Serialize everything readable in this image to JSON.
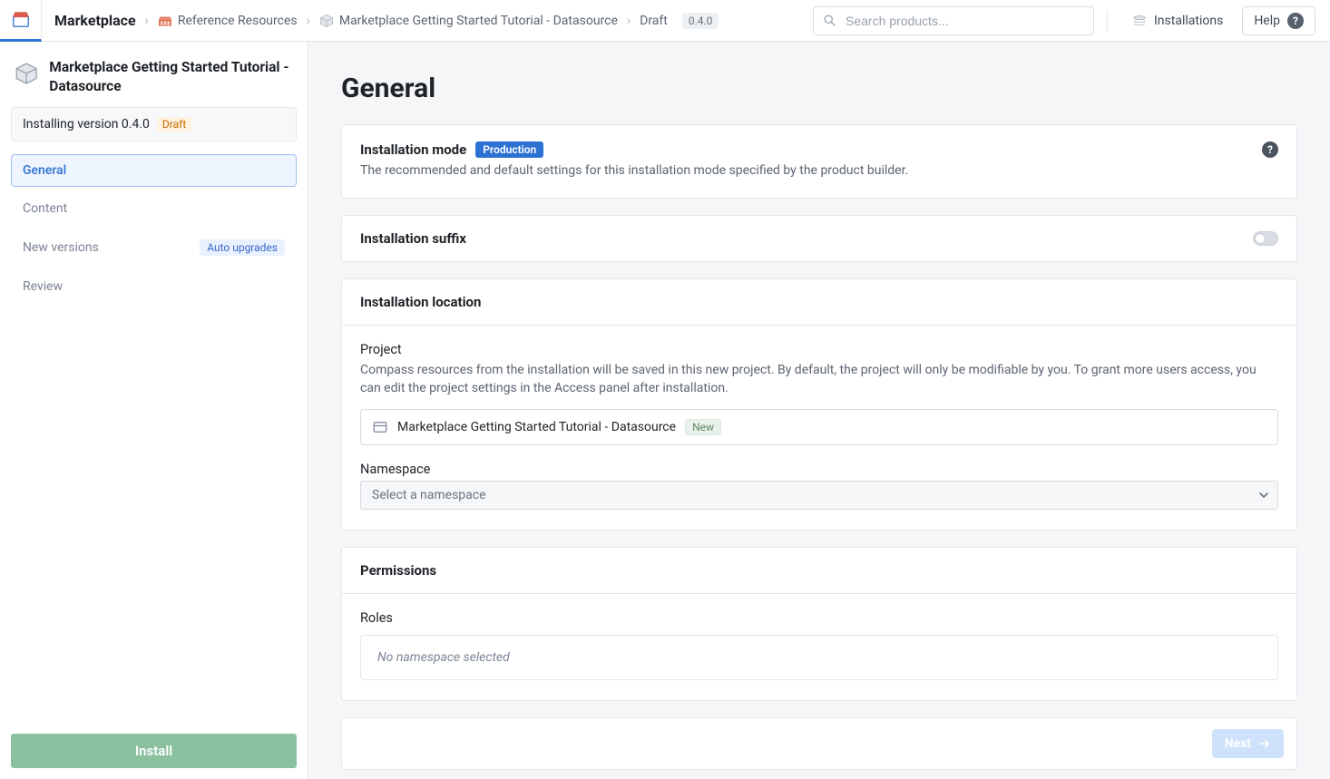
{
  "header": {
    "title": "Marketplace",
    "breadcrumbs": {
      "reference": "Reference Resources",
      "product": "Marketplace Getting Started Tutorial - Datasource",
      "stage": "Draft",
      "version": "0.4.0"
    },
    "search_placeholder": "Search products...",
    "installations": "Installations",
    "help": "Help"
  },
  "sidebar": {
    "title": "Marketplace Getting Started Tutorial - Datasource",
    "installing_line": "Installing version 0.4.0",
    "draft_label": "Draft",
    "nav": {
      "general": "General",
      "content": "Content",
      "new_versions": "New versions",
      "review": "Review"
    },
    "auto_upgrades": "Auto upgrades",
    "install": "Install"
  },
  "main": {
    "page_title": "General",
    "installation_mode": {
      "title": "Installation mode",
      "badge": "Production",
      "desc": "The recommended and default settings for this installation mode specified by the product builder."
    },
    "installation_suffix": {
      "title": "Installation suffix"
    },
    "installation_location": {
      "title": "Installation location",
      "project_label": "Project",
      "project_desc": "Compass resources from the installation will be saved in this new project. By default, the project will only be modifiable by you. To grant more users access, you can edit the project settings in the Access panel after installation.",
      "project_name": "Marketplace Getting Started Tutorial - Datasource",
      "new_tag": "New",
      "namespace_label": "Namespace",
      "namespace_placeholder": "Select a namespace"
    },
    "permissions": {
      "title": "Permissions",
      "roles_label": "Roles",
      "empty": "No namespace selected"
    },
    "footer": {
      "next": "Next"
    }
  }
}
